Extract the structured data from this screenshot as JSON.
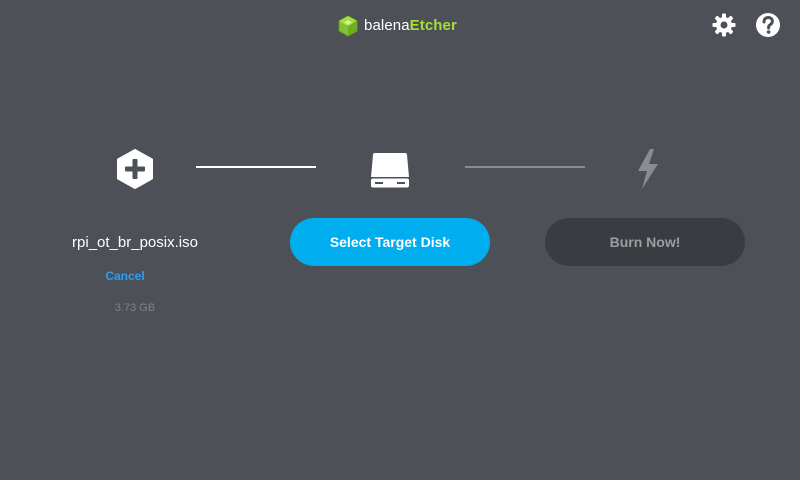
{
  "header": {
    "brand_balena": "balena",
    "brand_etcher": "Etcher",
    "logo_icon": "cube-logo-icon",
    "settings_icon": "gear-icon",
    "help_icon": "question-icon"
  },
  "steps": {
    "image": {
      "icon": "plus-hexagon-icon",
      "filename": "rpi_ot_br_posix.iso",
      "cancel_label": "Cancel",
      "size": "3.73 GB"
    },
    "drive": {
      "icon": "drive-icon",
      "button_label": "Select Target Disk"
    },
    "flash": {
      "icon": "lightning-icon",
      "button_label": "Burn Now!"
    }
  },
  "colors": {
    "background": "#4d5057",
    "accent_blue": "#00aeef",
    "link_blue": "#2a9df4",
    "brand_green": "#a5de37",
    "disabled_button": "#3a3c41"
  }
}
